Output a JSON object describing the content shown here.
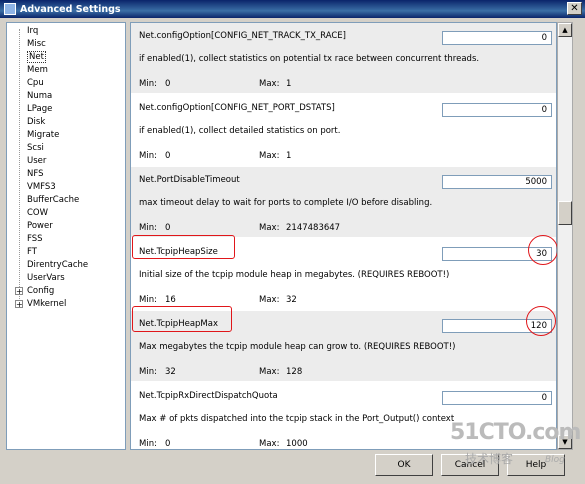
{
  "window": {
    "title": "Advanced Settings",
    "close_glyph": "✕"
  },
  "tree": {
    "items": [
      {
        "label": "Irq"
      },
      {
        "label": "Misc"
      },
      {
        "label": "Net"
      },
      {
        "label": "Mem"
      },
      {
        "label": "Cpu"
      },
      {
        "label": "Numa"
      },
      {
        "label": "LPage"
      },
      {
        "label": "Disk"
      },
      {
        "label": "Migrate"
      },
      {
        "label": "Scsi"
      },
      {
        "label": "User"
      },
      {
        "label": "NFS"
      },
      {
        "label": "VMFS3"
      },
      {
        "label": "BufferCache"
      },
      {
        "label": "COW"
      },
      {
        "label": "Power"
      },
      {
        "label": "FSS"
      },
      {
        "label": "FT"
      },
      {
        "label": "DirentryCache"
      },
      {
        "label": "UserVars"
      },
      {
        "label": "Config"
      },
      {
        "label": "VMkernel"
      }
    ],
    "selected": "Net",
    "expander_glyph": "+"
  },
  "options": [
    {
      "name": "Net.configOption[CONFIG_NET_TRACK_TX_RACE]",
      "desc": "if enabled(1), collect statistics on potential tx race between concurrent threads.",
      "min": "0",
      "max": "1",
      "value": "0"
    },
    {
      "name": "Net.configOption[CONFIG_NET_PORT_DSTATS]",
      "desc": "if enabled(1), collect detailed statistics on port.",
      "min": "0",
      "max": "1",
      "value": "0"
    },
    {
      "name": "Net.PortDisableTimeout",
      "desc": "max timeout delay to wait for ports to complete I/O before disabling.",
      "min": "0",
      "max": "2147483647",
      "value": "5000"
    },
    {
      "name": "Net.TcpipHeapSize",
      "desc": "Initial size of the tcpip module heap in megabytes. (REQUIRES REBOOT!)",
      "min": "16",
      "max": "32",
      "value": "30"
    },
    {
      "name": "Net.TcpipHeapMax",
      "desc": "Max megabytes the tcpip module heap can grow to. (REQUIRES REBOOT!)",
      "min": "32",
      "max": "128",
      "value": "120"
    },
    {
      "name": "Net.TcpipRxDirectDispatchQuota",
      "desc": "Max # of pkts dispatched into the tcpip stack in the Port_Output() context",
      "min": "0",
      "max": "1000",
      "value": "0"
    }
  ],
  "labels": {
    "min": "Min:",
    "max": "Max:"
  },
  "scrollbar": {
    "up": "▲",
    "down": "▼"
  },
  "buttons": {
    "ok": "OK",
    "cancel": "Cancel",
    "help": "Help"
  },
  "watermark": {
    "site": "51CTO.com",
    "tagline": "技术博客",
    "blog": "Blog"
  },
  "colors": {
    "highlight": "#e0161a",
    "title_bar": "#0a246a"
  }
}
